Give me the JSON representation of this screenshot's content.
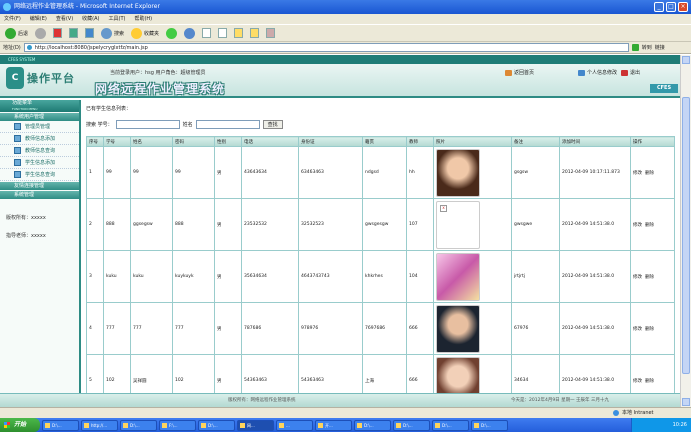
{
  "window": {
    "title": "网络远程作业管理系统 - Microsoft Internet Explorer"
  },
  "menu": [
    "文件(F)",
    "编辑(E)",
    "查看(V)",
    "收藏(A)",
    "工具(T)",
    "帮助(H)"
  ],
  "toolbar": {
    "back": "后退",
    "search": "搜索",
    "favorites": "收藏夹"
  },
  "address": {
    "label": "地址(D)",
    "url": "http://localhost:8080/jspelycryglxtfz/main.jsp",
    "go": "转到",
    "links": "链接"
  },
  "header": {
    "band": "CFES SYSTEM",
    "logo_mark": "C",
    "logo_text": "操作平台",
    "user_line": "当前登录用户：hsg   用户角色：超级管理员",
    "system_name": "网络远程作业管理系统",
    "links": [
      "返回首页",
      "个人信息修改",
      "退出"
    ],
    "badge": "CFES"
  },
  "sidebar": {
    "title": "功能菜单",
    "subtitle": "FUNCTION MENU",
    "groups": [
      {
        "label": "系统用户管理",
        "items": [
          "管理员管理",
          "教师信息添加",
          "教师信息查询",
          "学生信息添加",
          "学生信息查询"
        ]
      },
      {
        "label": "友情连接管理",
        "items": []
      },
      {
        "label": "系统管理",
        "items": []
      }
    ],
    "meta": [
      "版权所有：xxxxx",
      "指导老师：xxxxx"
    ]
  },
  "main": {
    "section_title": "已有学生信息列表：",
    "search": {
      "label_id": "搜索 学号：",
      "label_name": "姓名",
      "button": "查找"
    }
  },
  "table": {
    "headers": [
      "序号",
      "学号",
      "姓名",
      "密码",
      "性别",
      "电话",
      "身份证",
      "籍贯",
      "教师",
      "照片",
      "备注",
      "添加时间",
      "操作"
    ],
    "rows": [
      {
        "no": "1",
        "id": "99",
        "name": "99",
        "pwd": "99",
        "sex": "男",
        "tel": "43643634",
        "idcard": "63463463",
        "origin": "ndgsd",
        "teacher": "hh",
        "note": "gsgsw",
        "time": "2012-04-09 10:17:11.873",
        "edit": "修改",
        "del": "删除"
      },
      {
        "no": "2",
        "id": "888",
        "name": "ggsegsw",
        "pwd": "888",
        "sex": "男",
        "tel": "23532532",
        "idcard": "32532523",
        "origin": "gwsgesgw",
        "teacher": "107",
        "note": "gwsgwe",
        "time": "2012-04-09 14:51:38.0",
        "edit": "修改",
        "del": "删除"
      },
      {
        "no": "3",
        "id": "kuku",
        "name": "kuku",
        "pwd": "kuykuyk",
        "sex": "男",
        "tel": "35634634",
        "idcard": "4643743743",
        "origin": "khkrhes",
        "teacher": "104",
        "note": "jrtjrtj",
        "time": "2012-04-09 14:51:38.0",
        "edit": "修改",
        "del": "删除"
      },
      {
        "no": "4",
        "id": "777",
        "name": "777",
        "pwd": "777",
        "sex": "男",
        "tel": "787686",
        "idcard": "978976",
        "origin": "7697686",
        "teacher": "666",
        "note": "67976",
        "time": "2012-04-09 14:51:38.0",
        "edit": "修改",
        "del": "删除"
      },
      {
        "no": "5",
        "id": "102",
        "name": "吴祥圆",
        "pwd": "102",
        "sex": "男",
        "tel": "54363463",
        "idcard": "54363463",
        "origin": "上海",
        "teacher": "666",
        "note": "34634",
        "time": "2012-04-09 14:51:38.0",
        "edit": "修改",
        "del": "删除"
      }
    ]
  },
  "footer": {
    "left": "版权所有：网络远程作业管理系统",
    "right": "今天是：2012年4月9日 星期一 壬辰年 三月十九"
  },
  "status": {
    "zone": "本地 Intranet"
  },
  "taskbar": {
    "start": "开始",
    "tasks": [
      "D:\\...",
      "http://...",
      "D:\\...",
      "F:\\...",
      "D:\\...",
      "网...",
      "...",
      "开...",
      "D:\\...",
      "D:\\...",
      "D:\\...",
      "D:\\..."
    ],
    "time": "10:26"
  }
}
